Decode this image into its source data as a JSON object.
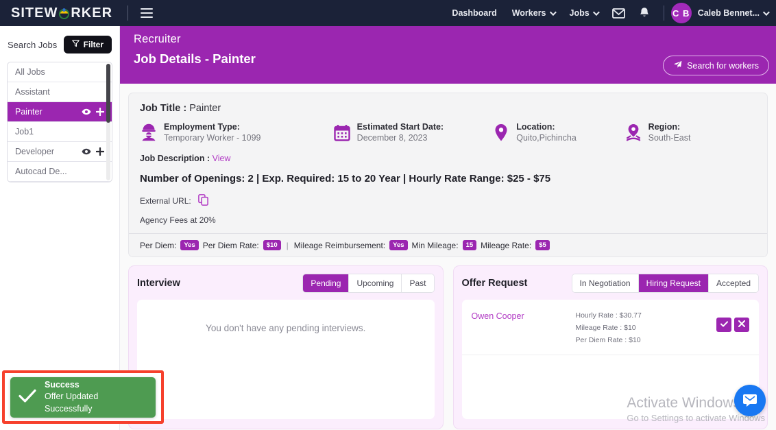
{
  "topnav": {
    "brand_part1": "SITEW",
    "brand_part2": "RKER",
    "links": [
      {
        "label": "Dashboard",
        "caret": false
      },
      {
        "label": "Workers",
        "caret": true
      },
      {
        "label": "Jobs",
        "caret": true
      }
    ],
    "mail_icon": "envelope-icon",
    "bell_icon": "bell-icon",
    "avatar_initials": "C B",
    "user_name": "Caleb Bennet..."
  },
  "sidebar": {
    "search_label": "Search Jobs",
    "filter_label": "Filter",
    "items": [
      {
        "label": "All Jobs",
        "active": false,
        "actions": false
      },
      {
        "label": "Assistant",
        "active": false,
        "actions": false
      },
      {
        "label": "Painter",
        "active": true,
        "actions": true
      },
      {
        "label": "Job1",
        "active": false,
        "actions": false
      },
      {
        "label": "Developer",
        "active": false,
        "actions": true
      },
      {
        "label": "Autocad De...",
        "active": false,
        "actions": false
      }
    ]
  },
  "header": {
    "subtitle": "Recruiter",
    "title": "Job Details - Painter",
    "search_workers_label": "Search for workers"
  },
  "job": {
    "title_label": "Job Title :",
    "title_value": "Painter",
    "meta": [
      {
        "icon": "hard-hat-worker-icon",
        "label": "Employment Type:",
        "value": "Temporary Worker - 1099"
      },
      {
        "icon": "calendar-icon",
        "label": "Estimated Start Date:",
        "value": "December 8, 2023"
      },
      {
        "icon": "map-pin-icon",
        "label": "Location:",
        "value": "Quito,Pichincha"
      },
      {
        "icon": "region-pin-icon",
        "label": "Region:",
        "value": "South-East"
      }
    ],
    "description_label": "Job Description :",
    "description_link": "View",
    "openings_line": "Number of Openings: 2 | Exp. Required: 15 to 20 Year | Hourly Rate Range: $25 - $75",
    "external_url_label": "External URL:",
    "external_url_icon": "copy-icon",
    "agency_fees": "Agency Fees at 20%",
    "footer": {
      "per_diem_label": "Per Diem:",
      "per_diem_value": "Yes",
      "per_diem_rate_label": "Per Diem Rate:",
      "per_diem_rate_value": "$10",
      "separator": "|",
      "mileage_reimb_label": "Mileage Reimbursement:",
      "mileage_reimb_value": "Yes",
      "min_mileage_label": "Min Mileage:",
      "min_mileage_value": "15",
      "mileage_rate_label": "Mileage Rate:",
      "mileage_rate_value": "$5"
    }
  },
  "interview": {
    "title": "Interview",
    "tabs": [
      {
        "label": "Pending",
        "active": true
      },
      {
        "label": "Upcoming",
        "active": false
      },
      {
        "label": "Past",
        "active": false
      }
    ],
    "empty_message": "You don't have any pending interviews."
  },
  "offer_request": {
    "title": "Offer Request",
    "tabs": [
      {
        "label": "In Negotiation",
        "active": false
      },
      {
        "label": "Hiring Request",
        "active": true
      },
      {
        "label": "Accepted",
        "active": false
      }
    ],
    "rows": [
      {
        "name": "Owen Cooper",
        "hourly_rate": "Hourly Rate : $30.77",
        "mileage_rate": "Mileage Rate : $10",
        "per_diem_rate": "Per Diem Rate : $10",
        "accept_icon": "check-icon",
        "reject_icon": "close-icon"
      }
    ]
  },
  "toast": {
    "icon": "check-icon",
    "title": "Success",
    "message": "Offer Updated Successfully"
  },
  "watermark": {
    "line1": "Activate Windows",
    "line2": "Go to Settings to activate Windows"
  },
  "chat": {
    "icon": "chat-bubble-icon"
  },
  "colors": {
    "brand_purple": "#9b26b0",
    "nav_dark": "#1b2238",
    "success_green": "#4e9b51",
    "highlight_red": "#f6402c",
    "chat_blue": "#1878f2",
    "panel_pink": "#fbeefd"
  }
}
